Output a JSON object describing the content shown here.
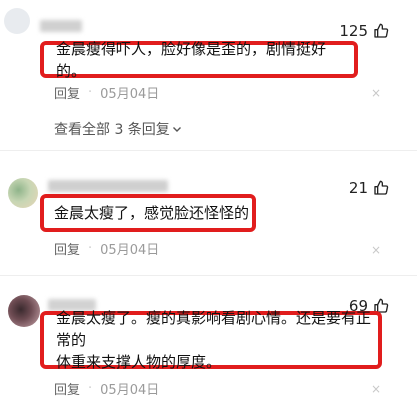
{
  "comments": [
    {
      "likes": "125",
      "text": "金晨瘦得吓人，脸好像是歪的，剧情挺好的。",
      "reply_label": "回复",
      "dot": "·",
      "date": "05月04日",
      "close": "×",
      "view_all": "查看全部 3 条回复"
    },
    {
      "likes": "21",
      "text": "金晨太瘦了，感觉脸还怪怪的",
      "reply_label": "回复",
      "dot": "·",
      "date": "05月04日",
      "close": "×"
    },
    {
      "likes": "69",
      "text_line1": "金晨太瘦了。瘦的真影响看剧心情。还是要有正常的",
      "text_line2": "体重来支撑人物的厚度。",
      "reply_label": "回复",
      "dot": "·",
      "date": "05月04日",
      "close": "×"
    }
  ],
  "colors": {
    "highlight": "#e11d1d",
    "meta": "#9a9a9a"
  },
  "icons": {
    "like": "thumbs-up-icon",
    "expand": "chevron-down-icon",
    "dismiss": "close-icon"
  }
}
